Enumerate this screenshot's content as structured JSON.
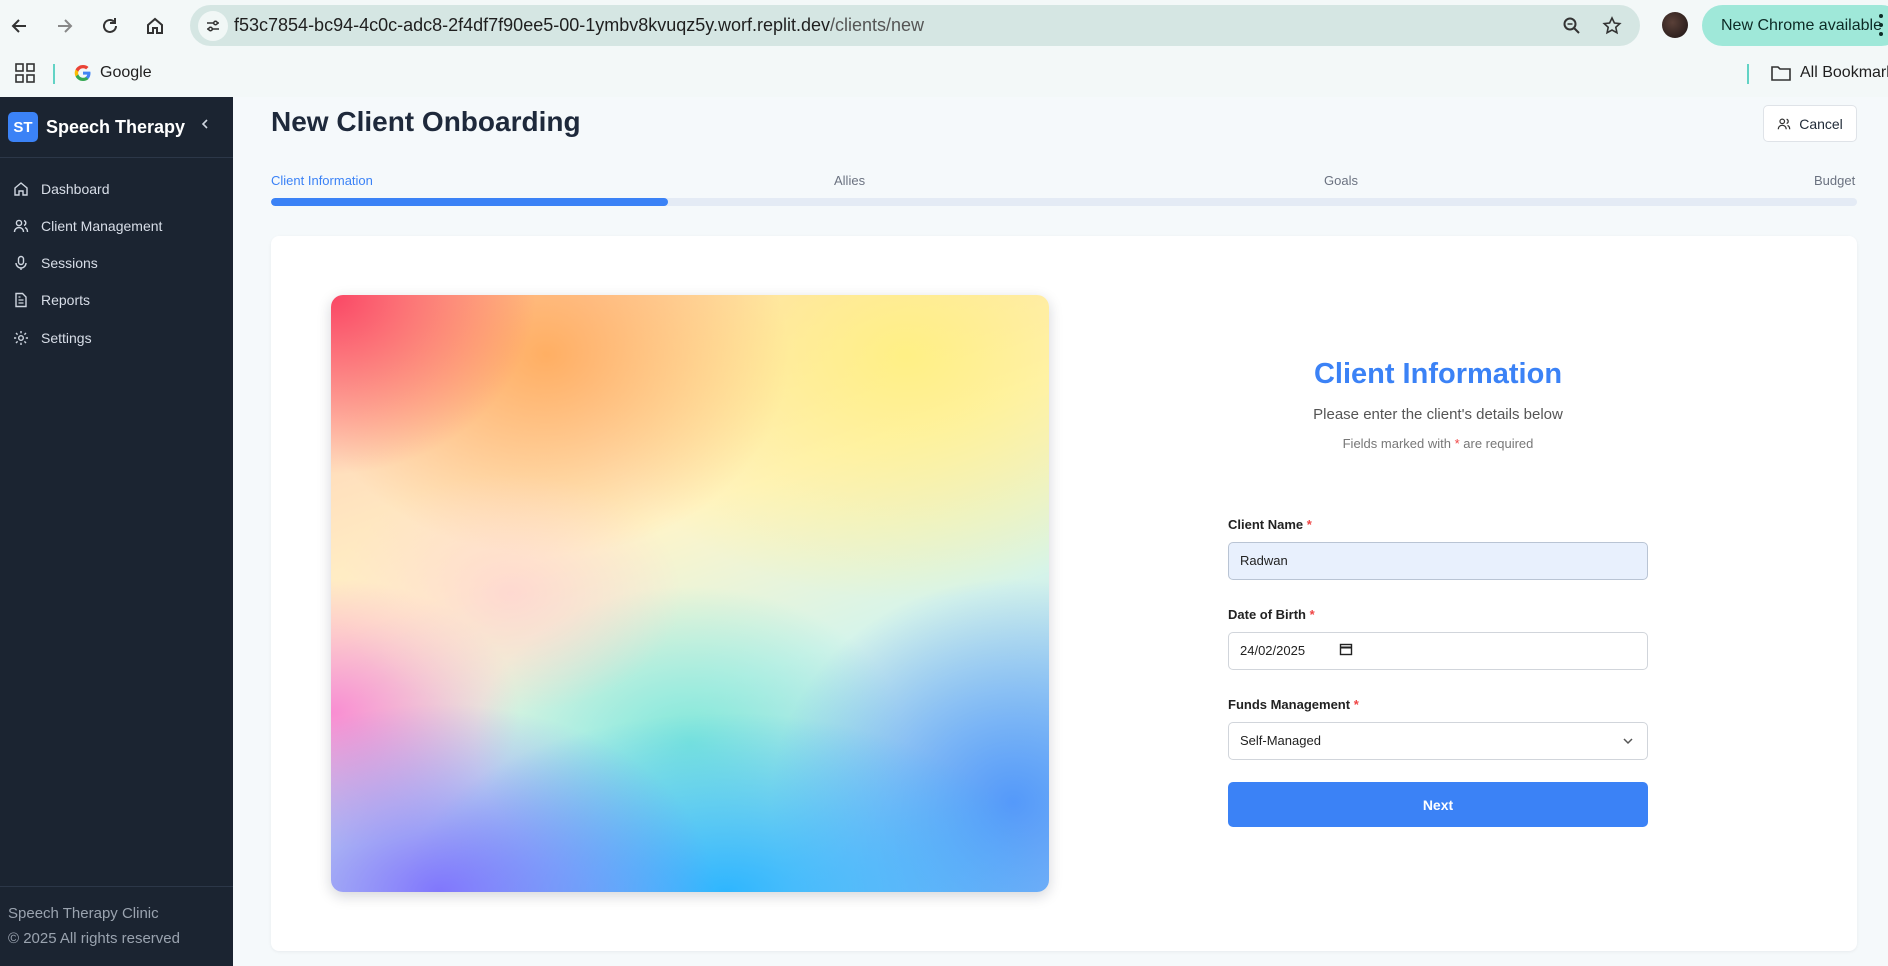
{
  "browser": {
    "url_host": "f53c7854-bc94-4c0c-adc8-2f4df7f90ee5-00-1ymbv8kvuqz5y.worf.replit.dev",
    "url_path": "/clients/new",
    "update_label": "New Chrome available",
    "bookmarks": {
      "google": "Google",
      "all": "All Bookmarks"
    }
  },
  "sidebar": {
    "logo": "ST",
    "title": "Speech Therapy",
    "items": [
      {
        "label": "Dashboard",
        "icon": "home-icon"
      },
      {
        "label": "Client Management",
        "icon": "users-icon"
      },
      {
        "label": "Sessions",
        "icon": "microphone-icon"
      },
      {
        "label": "Reports",
        "icon": "document-icon"
      },
      {
        "label": "Settings",
        "icon": "gear-icon"
      }
    ],
    "footer": {
      "clinic": "Speech Therapy Clinic",
      "copyright": "© 2025 All rights reserved"
    }
  },
  "header": {
    "title": "New Client Onboarding",
    "cancel_label": "Cancel"
  },
  "steps": {
    "items": [
      "Client Information",
      "Allies",
      "Goals",
      "Budget"
    ],
    "active_index": 0,
    "progress_fraction": 0.25
  },
  "form": {
    "title": "Client Information",
    "subtitle": "Please enter the client's details below",
    "note_prefix": "Fields marked with ",
    "note_star": "*",
    "note_suffix": " are required",
    "name_label": "Client Name",
    "name_value": "Radwan",
    "dob_label": "Date of Birth",
    "dob_value": "24/02/2025",
    "funds_label": "Funds Management",
    "funds_value": "Self-Managed",
    "required_mark": "*",
    "next_label": "Next"
  },
  "colors": {
    "accent": "#3b82f6",
    "sidebar_bg": "#1b2431",
    "required": "#ef4444"
  }
}
